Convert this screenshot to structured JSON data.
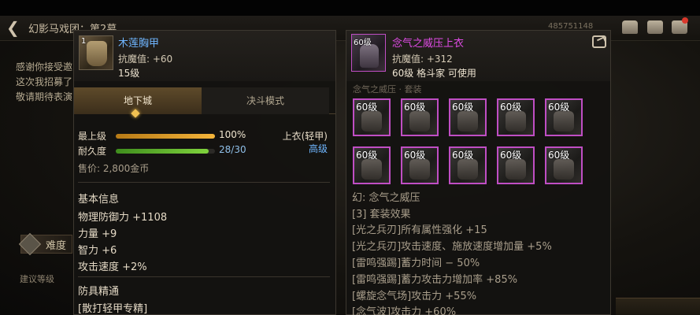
{
  "background": {
    "nav_title": "幻影马戏团：第2幕",
    "nav_right_text": "485751148",
    "intro_lines": [
      "感谢你接受邀",
      "这次我招募了",
      "敬请期待表演"
    ],
    "difficulty_label": "难度",
    "hint_label": "建议等级"
  },
  "left": {
    "name": "木莲胸甲",
    "name_color": "#6fb6ff",
    "icon_level": "1",
    "anti_magic": "抗魔值: +60",
    "level": "15级",
    "tabs": [
      "地下城",
      "决斗模式"
    ],
    "stats": [
      {
        "label": "最上级",
        "value": "100%",
        "fill": 1.0
      },
      {
        "label": "耐久度",
        "value": "28/30",
        "fill": 0.933
      }
    ],
    "slot": "上衣(轻甲)",
    "grade": "高级",
    "grade_color": "#6fb6ff",
    "price": "售价: 2,800金币",
    "basic_title": "基本信息",
    "basic_lines": [
      "物理防御力 +1108",
      "力量 +9",
      "智力 +6",
      "攻击速度 +2%"
    ],
    "mastery_title": "防具精通",
    "mastery_lines": [
      "[散打轻甲专精]"
    ]
  },
  "right": {
    "name": "念气之威压上衣",
    "name_color": "#e24ce8",
    "icon_level": "60级",
    "anti_magic": "抗魔值: +312",
    "level_class": "60级 格斗家 可使用",
    "faded_text": "念气之威压 · 套装",
    "set_item_level": "60级",
    "set_count": 10,
    "set_name": "幻: 念气之威压",
    "set_bonus_title": "[3] 套装效果",
    "set_lines": [
      "[光之兵刃]所有属性强化 +15",
      "[光之兵刃]攻击速度、施放速度增加量 +5%",
      "[雷鸣强踢]蓄力时间 − 50%",
      "[雷鸣强踢]蓄力攻击力增加率 +85%",
      "[螺旋念气场]攻击力 +55%",
      "[念气波]攻击力 +60%"
    ]
  }
}
